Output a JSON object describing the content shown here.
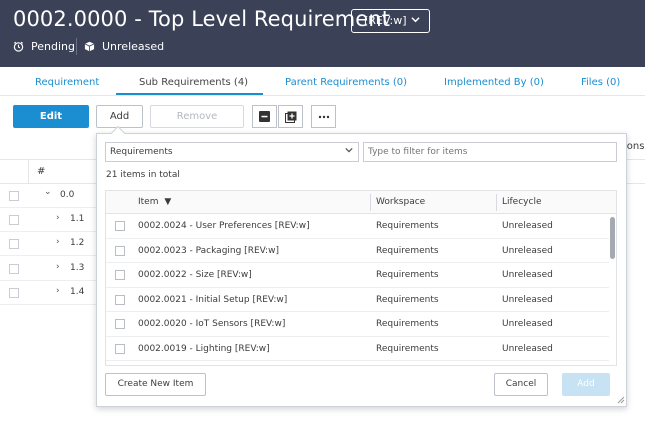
{
  "header": {
    "title": "0002.0000 - Top Level Requirement",
    "revision": "[REV:w]",
    "status": "Pending",
    "release": "Unreleased",
    "icons": [
      "clock-icon",
      "cube-icon",
      "chevron-down-icon"
    ]
  },
  "tabs": [
    {
      "label": "Requirement",
      "active": false
    },
    {
      "label": "Sub Requirements (4)",
      "active": true
    },
    {
      "label": "Parent Requirements (0)",
      "active": false
    },
    {
      "label": "Implemented By (0)",
      "active": false
    },
    {
      "label": "Files (0)",
      "active": false
    }
  ],
  "toolbar": {
    "edit_label": "Edit",
    "add_label": "Add",
    "remove_label": "Remove",
    "icons": [
      "collapse-icon",
      "add-linked-icon",
      "more-icon"
    ]
  },
  "background_table": {
    "hash_header": "#",
    "truncated_header": "ions",
    "rows": [
      {
        "num": "0.0",
        "chevron": "⌄"
      },
      {
        "num": "1.1",
        "chevron": "›"
      },
      {
        "num": "1.2",
        "chevron": "›"
      },
      {
        "num": "1.3",
        "chevron": "›"
      },
      {
        "num": "1.4",
        "chevron": "›"
      }
    ]
  },
  "add_dialog": {
    "workspace_value": "Requirements",
    "filter_placeholder": "Type to filter for items",
    "total_text": "21 items in total",
    "columns": {
      "item": "Item",
      "sort_indicator": "▼",
      "workspace": "Workspace",
      "lifecycle": "Lifecycle"
    },
    "rows": [
      {
        "item": "0002.0024 - User Preferences [REV:w]",
        "workspace": "Requirements",
        "lifecycle": "Unreleased"
      },
      {
        "item": "0002.0023 - Packaging [REV:w]",
        "workspace": "Requirements",
        "lifecycle": "Unreleased"
      },
      {
        "item": "0002.0022 - Size [REV:w]",
        "workspace": "Requirements",
        "lifecycle": "Unreleased"
      },
      {
        "item": "0002.0021 - Initial Setup [REV:w]",
        "workspace": "Requirements",
        "lifecycle": "Unreleased"
      },
      {
        "item": "0002.0020 - IoT Sensors [REV:w]",
        "workspace": "Requirements",
        "lifecycle": "Unreleased"
      },
      {
        "item": "0002.0019 - Lighting [REV:w]",
        "workspace": "Requirements",
        "lifecycle": "Unreleased"
      },
      {
        "item": "",
        "workspace": "",
        "lifecycle": ""
      }
    ],
    "create_label": "Create New Item",
    "cancel_label": "Cancel",
    "add_label": "Add"
  },
  "colors": {
    "header_bg": "#3b4257",
    "accent": "#1a8ed0",
    "disabled_accent": "#c6e2f3"
  }
}
